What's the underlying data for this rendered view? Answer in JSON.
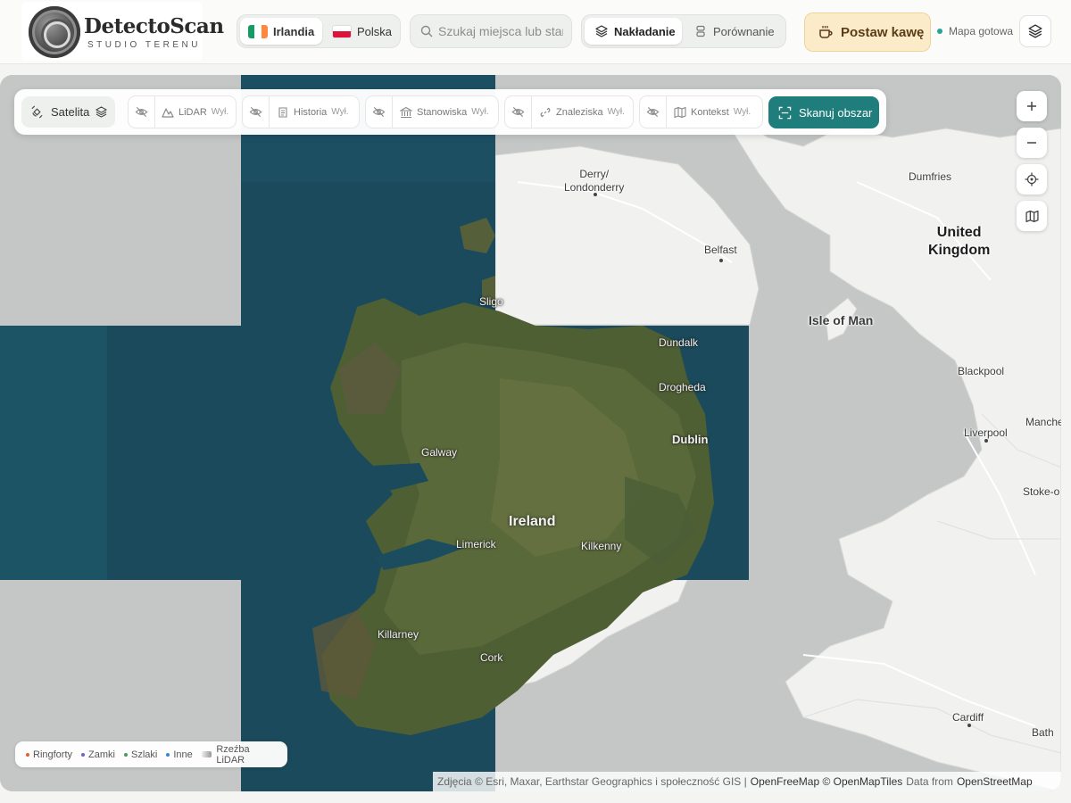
{
  "header": {
    "brand_name": "DetectoScan",
    "brand_subtitle": "STUDIO TERENU",
    "countries": [
      {
        "label": "Irlandia",
        "active": true
      },
      {
        "label": "Polska",
        "active": false
      }
    ],
    "search": {
      "placeholder": "Szukaj miejsca lub stan"
    },
    "modes": [
      {
        "label": "Nakładanie",
        "active": true
      },
      {
        "label": "Porównanie",
        "active": false
      }
    ],
    "coffee_label": "Postaw kawę",
    "status_text": "Mapa gotowa",
    "status_color": "#2aa198"
  },
  "toolbar": {
    "base_layer": "Satelita",
    "layers": [
      {
        "label": "LiDAR",
        "state": "Wył."
      },
      {
        "label": "Historia",
        "state": "Wył."
      },
      {
        "label": "Stanowiska",
        "state": "Wył."
      },
      {
        "label": "Znaleziska",
        "state": "Wył."
      },
      {
        "label": "Kontekst",
        "state": "Wył."
      }
    ],
    "scan_label": "Skanuj obszar",
    "accent_color": "#1f7e7b"
  },
  "map": {
    "labels": {
      "derry": "Derry/\nLondonderry",
      "dumfries": "Dumfries",
      "belfast": "Belfast",
      "uk": "United\nKingdom",
      "sligo": "Sligo",
      "isle_of_man": "Isle of Man",
      "dundalk": "Dundalk",
      "blackpool": "Blackpool",
      "drogheda": "Drogheda",
      "manchester": "Manche",
      "liverpool": "Liverpool",
      "dublin": "Dublin",
      "galway": "Galway",
      "stoke": "Stoke-o",
      "ireland": "Ireland",
      "limerick": "Limerick",
      "kilkenny": "Kilkenny",
      "killarney": "Killarney",
      "cork": "Cork",
      "cardiff": "Cardiff",
      "bath": "Bath"
    }
  },
  "legend": {
    "items": [
      {
        "label": "Ringforty",
        "color": "#e0603a"
      },
      {
        "label": "Zamki",
        "color": "#7b5fc6"
      },
      {
        "label": "Szlaki",
        "color": "#4a9a5a"
      },
      {
        "label": "Inne",
        "color": "#3a86c8"
      }
    ],
    "lidar_label": "Rzeźba LiDAR"
  },
  "attribution": {
    "imagery": "Zdjęcia © Esri, Maxar, Earthstar Geographics i społeczność GIS |",
    "tiles": "OpenFreeMap © OpenMapTiles",
    "data_prefix": "Data from",
    "data_source": "OpenStreetMap"
  }
}
